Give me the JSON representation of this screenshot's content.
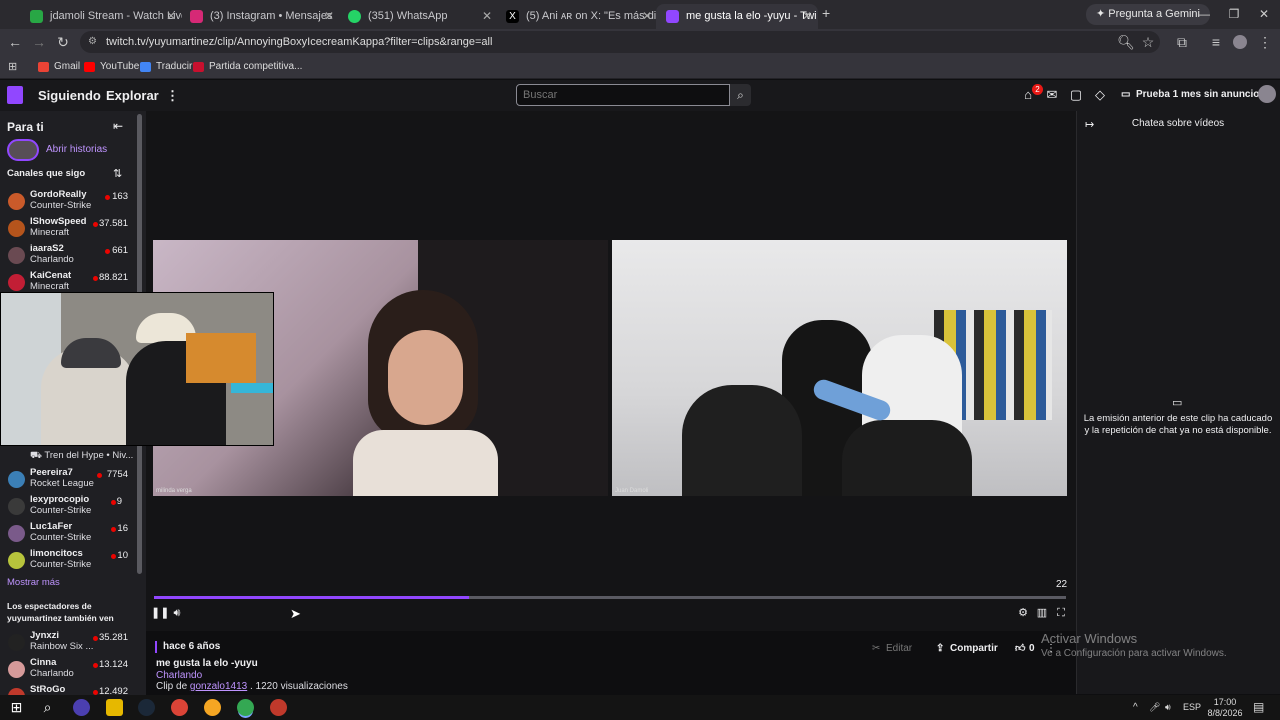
{
  "browser": {
    "tabs": [
      {
        "title": "jdamoli Stream - Watch Live on",
        "color": "#28a745"
      },
      {
        "title": "(3) Instagram • Mensajes",
        "color": "#d62976"
      },
      {
        "title": "(351) WhatsApp",
        "color": "#25d366"
      },
      {
        "title": "(5) Ani ᴀʀ on X: \"Es más difícil c",
        "color": "#000000"
      },
      {
        "title": "me gusta la elo -yuyu - Twi",
        "color": "#9147ff"
      }
    ],
    "gemini_label": "Pregunta a Gemini",
    "url": "twitch.tv/yuyumartinez/clip/AnnoyingBoxyIcecreamKappa?filter=clips&range=all",
    "bookmarks": [
      {
        "label": "Gmail",
        "color": "#ea4335"
      },
      {
        "label": "YouTube",
        "color": "#ff0000"
      },
      {
        "label": "Traducir",
        "color": "#4285f4"
      },
      {
        "label": "Partida competitiva...",
        "color": "#c8102e"
      }
    ]
  },
  "twitch": {
    "nav": {
      "following": "Siguiendo",
      "explore": "Explorar",
      "search_placeholder": "Buscar",
      "notification_count": "2",
      "prime_label": "Prueba 1 mes sin anuncios"
    },
    "sidebar": {
      "for_you": "Para ti",
      "stories": "Abrir historias",
      "followed_header": "Canales que sigo",
      "channels_top": [
        {
          "name": "GordoReally",
          "game": "Counter-Strike",
          "viewers": "163",
          "color": "#c95a2a"
        },
        {
          "name": "IShowSpeed",
          "game": "Minecraft",
          "viewers": "37.581",
          "color": "#b5541c"
        },
        {
          "name": "iaaraS2",
          "game": "Charlando",
          "viewers": "661",
          "color": "#6a4a52"
        },
        {
          "name": "KaiCenat",
          "game": "Minecraft",
          "viewers": "88.821",
          "color": "#c21e35"
        }
      ],
      "hype_train": "Tren del Hype • Niv...",
      "channels_bottom": [
        {
          "name": "Peereira7",
          "game": "Rocket League",
          "viewers": "7754",
          "color": "#3b7fb6"
        },
        {
          "name": "lexyprocopio",
          "game": "Counter-Strike",
          "viewers": "9",
          "color": "#3a3a3a"
        },
        {
          "name": "Luc1aFer",
          "game": "Counter-Strike",
          "viewers": "16",
          "color": "#7a5a8a"
        },
        {
          "name": "limoncitocs",
          "game": "Counter-Strike",
          "viewers": "10",
          "color": "#b7c43c"
        }
      ],
      "show_more": "Mostrar más",
      "also_watch_header": "Los espectadores de yuyumartinez también ven",
      "also_watch": [
        {
          "name": "Jynxzi",
          "game": "Rainbow Six ...",
          "viewers": "35.281",
          "color": "#222222"
        },
        {
          "name": "Cinna",
          "game": "Charlando",
          "viewers": "13.124",
          "color": "#d69a9a"
        },
        {
          "name": "StRoGo",
          "game": "",
          "viewers": "12.492",
          "color": "#c0392b"
        }
      ]
    },
    "player": {
      "cam_left_caption": "milinda verga",
      "cam_right_caption": "Juan Damoli",
      "timecode": "22",
      "progress_fraction": 0.345
    },
    "clip": {
      "age": "hace 6 años",
      "title": "me gusta la elo -yuyu",
      "category": "Charlando",
      "clip_prefix": "Clip de",
      "clipper": "gonzalo1413",
      "views": ". 1220 visualizaciones",
      "edit": "Editar",
      "share": "Compartir",
      "likes": "0"
    },
    "chat": {
      "title": "Chatea sobre vídeos",
      "message": "La emisión anterior de este clip ha caducado y la repetición de chat ya no está disponible."
    }
  },
  "windows": {
    "watermark_title": "Activar Windows",
    "watermark_sub": "Ve a Configuración para activar Windows.",
    "lang": "ESP",
    "time": "17:00",
    "date": "8/8/2026"
  }
}
